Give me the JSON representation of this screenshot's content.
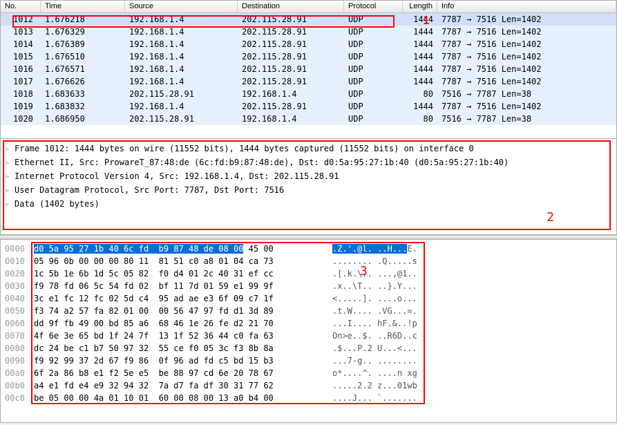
{
  "table": {
    "headers": {
      "no": "No.",
      "time": "Time",
      "source": "Source",
      "destination": "Destination",
      "protocol": "Protocol",
      "length": "Length",
      "info": "Info"
    },
    "rows": [
      {
        "no": "1012",
        "time": "1.676218",
        "source": "192.168.1.4",
        "dest": "202.115.28.91",
        "proto": "UDP",
        "len": "1444",
        "info": "7787 → 7516 Len=1402"
      },
      {
        "no": "1013",
        "time": "1.676329",
        "source": "192.168.1.4",
        "dest": "202.115.28.91",
        "proto": "UDP",
        "len": "1444",
        "info": "7787 → 7516 Len=1402"
      },
      {
        "no": "1014",
        "time": "1.676389",
        "source": "192.168.1.4",
        "dest": "202.115.28.91",
        "proto": "UDP",
        "len": "1444",
        "info": "7787 → 7516 Len=1402"
      },
      {
        "no": "1015",
        "time": "1.676510",
        "source": "192.168.1.4",
        "dest": "202.115.28.91",
        "proto": "UDP",
        "len": "1444",
        "info": "7787 → 7516 Len=1402"
      },
      {
        "no": "1016",
        "time": "1.676571",
        "source": "192.168.1.4",
        "dest": "202.115.28.91",
        "proto": "UDP",
        "len": "1444",
        "info": "7787 → 7516 Len=1402"
      },
      {
        "no": "1017",
        "time": "1.676626",
        "source": "192.168.1.4",
        "dest": "202.115.28.91",
        "proto": "UDP",
        "len": "1444",
        "info": "7787 → 7516 Len=1402"
      },
      {
        "no": "1018",
        "time": "1.683633",
        "source": "202.115.28.91",
        "dest": "192.168.1.4",
        "proto": "UDP",
        "len": "80",
        "info": "7516 → 7787 Len=38"
      },
      {
        "no": "1019",
        "time": "1.683832",
        "source": "192.168.1.4",
        "dest": "202.115.28.91",
        "proto": "UDP",
        "len": "1444",
        "info": "7787 → 7516 Len=1402"
      },
      {
        "no": "1020",
        "time": "1.686950",
        "source": "202.115.28.91",
        "dest": "192.168.1.4",
        "proto": "UDP",
        "len": "80",
        "info": "7516 → 7787 Len=38"
      }
    ]
  },
  "details": {
    "lines": [
      "Frame 1012: 1444 bytes on wire (11552 bits), 1444 bytes captured (11552 bits) on interface 0",
      "Ethernet II, Src: ProwareT_87:48:de (6c:fd:b9:87:48:de), Dst: d0:5a:95:27:1b:40 (d0:5a:95:27:1b:40)",
      "Internet Protocol Version 4, Src: 192.168.1.4, Dst: 202.115.28.91",
      "User Datagram Protocol, Src Port: 7787, Dst Port: 7516",
      "Data (1402 bytes)"
    ]
  },
  "hex": {
    "lines": [
      {
        "off": "0000",
        "sel": "d0 5a 95 27 1b 40 6c fd  b9 87 48 de 08 00",
        "rest": " 45 00",
        "asciisel": ".Z.'.@l. ..H...",
        "asciirest": "E."
      },
      {
        "off": "0010",
        "sel": "",
        "rest": "05 96 0b 00 00 00 80 11  81 51 c0 a8 01 04 ca 73",
        "asciisel": "",
        "asciirest": "........ .Q.....s"
      },
      {
        "off": "0020",
        "sel": "",
        "rest": "1c 5b 1e 6b 1d 5c 05 82  f0 d4 01 2c 40 31 ef cc",
        "asciisel": "",
        "asciirest": ".[.k.\\.. ...,@1.."
      },
      {
        "off": "0030",
        "sel": "",
        "rest": "f9 78 fd 06 5c 54 fd 02  bf 11 7d 01 59 e1 99 9f",
        "asciisel": "",
        "asciirest": ".x..\\T.. ..}.Y..."
      },
      {
        "off": "0040",
        "sel": "",
        "rest": "3c e1 fc 12 fc 02 5d c4  95 ad ae e3 6f 09 c7 1f",
        "asciisel": "",
        "asciirest": "<.....]. ....o..."
      },
      {
        "off": "0050",
        "sel": "",
        "rest": "f3 74 a2 57 fa 82 01 00  00 56 47 97 fd d1 3d 89",
        "asciisel": "",
        "asciirest": ".t.W.... .VG...=."
      },
      {
        "off": "0060",
        "sel": "",
        "rest": "dd 9f fb 49 00 bd 85 a6  68 46 1e 26 fe d2 21 70",
        "asciisel": "",
        "asciirest": "...I.... hF.&..!p"
      },
      {
        "off": "0070",
        "sel": "",
        "rest": "4f 6e 3e 65 bd 1f 24 7f  13 1f 52 36 44 c0 fa 63",
        "asciisel": "",
        "asciirest": "On>e..$. ..R6D..c"
      },
      {
        "off": "0080",
        "sel": "",
        "rest": "dc 24 be c1 b7 50 97 32  55 ce f0 05 3c f3 8b 8a",
        "asciisel": "",
        "asciirest": ".$...P.2 U...<..."
      },
      {
        "off": "0090",
        "sel": "",
        "rest": "f9 92 99 37 2d 67 f9 86  0f 96 ad fd c5 bd 15 b3",
        "asciisel": "",
        "asciirest": "...7-g.. ........"
      },
      {
        "off": "00a0",
        "sel": "",
        "rest": "6f 2a 86 b8 e1 f2 5e e5  be 88 97 cd 6e 20 78 67",
        "asciisel": "",
        "asciirest": "o*....^. ....n xg"
      },
      {
        "off": "00b0",
        "sel": "",
        "rest": "a4 e1 fd e4 e9 32 94 32  7a d7 fa df 30 31 77 62",
        "asciisel": "",
        "asciirest": ".....2.2 z...01wb"
      },
      {
        "off": "00c0",
        "sel": "",
        "rest": "be 05 00 00 4a 01 10 01  60 00 08 00 13 a0 b4 00",
        "asciisel": "",
        "asciirest": "....J... `......."
      }
    ]
  },
  "annotations": {
    "a1": "1",
    "a2": "2",
    "a3": "3"
  }
}
